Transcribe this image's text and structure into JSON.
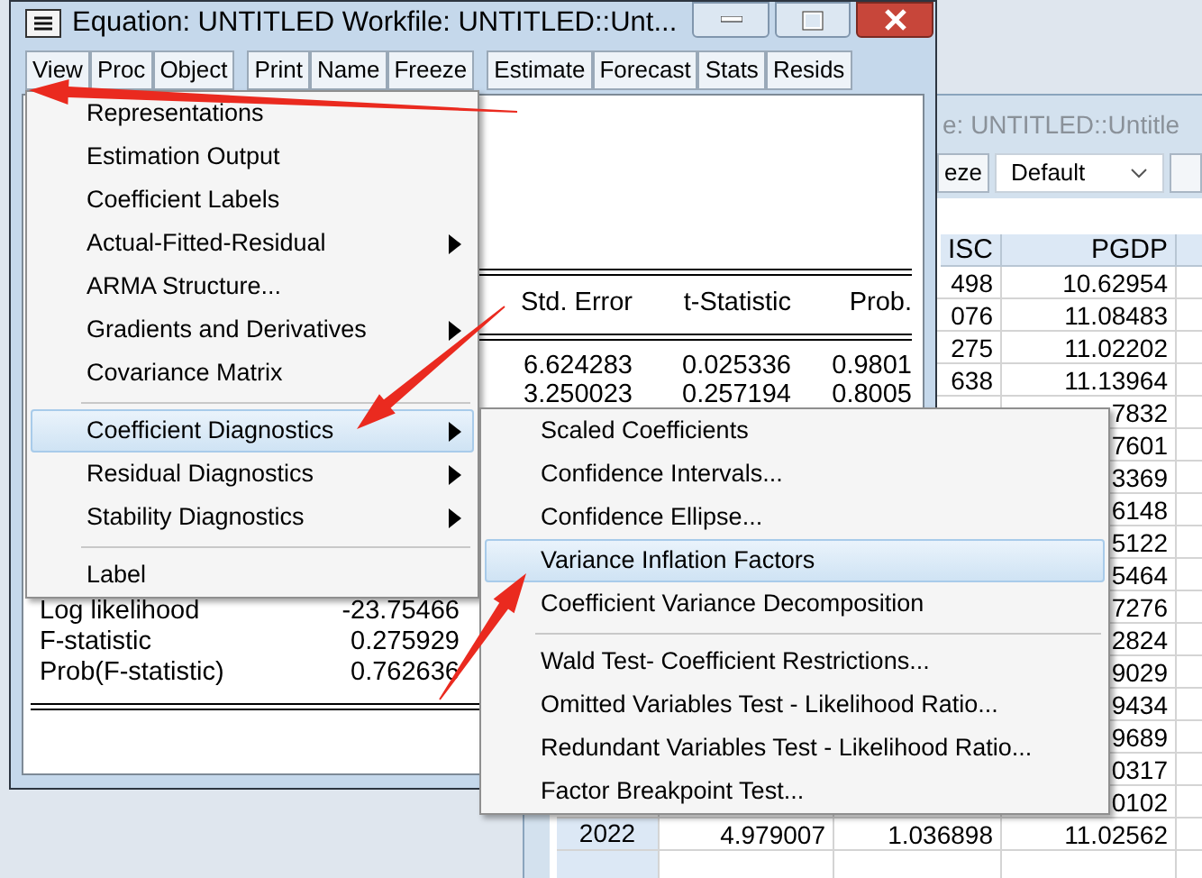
{
  "data_window": {
    "title": "e: UNTITLED::Untitle",
    "toolbar_button": "eze",
    "dropdown": "Default",
    "columns": {
      "isc": "ISC",
      "pgdp": "PGDP"
    },
    "rows": [
      {
        "isc": "498",
        "pgdp": "10.62954"
      },
      {
        "isc": "076",
        "pgdp": "11.08483"
      },
      {
        "isc": "275",
        "pgdp": "11.02202"
      },
      {
        "isc": "638",
        "pgdp": "11.13964"
      },
      {
        "pgdp": "7832"
      },
      {
        "pgdp": "7601"
      },
      {
        "pgdp": "3369"
      },
      {
        "pgdp": "6148"
      },
      {
        "pgdp": "5122"
      },
      {
        "pgdp": "5464"
      },
      {
        "pgdp": "7276"
      },
      {
        "pgdp": "2824"
      },
      {
        "pgdp": "9029"
      },
      {
        "pgdp": "9434"
      },
      {
        "pgdp": "9689"
      },
      {
        "pgdp": "0317"
      },
      {
        "pgdp": "0102"
      },
      {
        "obs": "2022",
        "column_2": "4.979007",
        "isc": "1.036898",
        "pgdp": "11.02562"
      }
    ]
  },
  "equation_window": {
    "title": "Equation: UNTITLED   Workfile: UNTITLED::Unt...",
    "toolbar_groups": [
      [
        "View",
        "Proc",
        "Object"
      ],
      [
        "Print",
        "Name",
        "Freeze"
      ],
      [
        "Estimate",
        "Forecast",
        "Stats",
        "Resids"
      ]
    ],
    "output": {
      "header": [
        "Std. Error",
        "t-Statistic",
        "Prob."
      ],
      "rows": [
        [
          "6.624283",
          "0.025336",
          "0.9801"
        ],
        [
          "3.250023",
          "0.257194",
          "0.8005"
        ]
      ],
      "stats": [
        {
          "label": "Log likelihood",
          "value": "-23.75466"
        },
        {
          "label": "F-statistic",
          "value": "0.275929"
        },
        {
          "label": "Prob(F-statistic)",
          "value": "0.762636"
        }
      ]
    }
  },
  "view_menu": {
    "items": [
      {
        "label": "Representations",
        "submenu": false,
        "selected": false
      },
      {
        "label": "Estimation Output",
        "submenu": false,
        "selected": false
      },
      {
        "label": "Coefficient Labels",
        "submenu": false,
        "selected": false
      },
      {
        "label": "Actual-Fitted-Residual",
        "submenu": true,
        "selected": false
      },
      {
        "label": "ARMA Structure...",
        "submenu": false,
        "selected": false
      },
      {
        "label": "Gradients and Derivatives",
        "submenu": true,
        "selected": false
      },
      {
        "label": "Covariance Matrix",
        "submenu": false,
        "selected": false
      },
      {
        "kind": "separator"
      },
      {
        "label": "Coefficient Diagnostics",
        "submenu": true,
        "selected": true
      },
      {
        "label": "Residual Diagnostics",
        "submenu": true,
        "selected": false
      },
      {
        "label": "Stability Diagnostics",
        "submenu": true,
        "selected": false
      },
      {
        "kind": "separator"
      },
      {
        "label": "Label",
        "submenu": false,
        "selected": false
      }
    ]
  },
  "submenu": {
    "items": [
      {
        "label": "Scaled Coefficients",
        "selected": false
      },
      {
        "label": "Confidence Intervals...",
        "selected": false
      },
      {
        "label": "Confidence Ellipse...",
        "selected": false
      },
      {
        "label": "Variance Inflation Factors",
        "selected": true
      },
      {
        "label": "Coefficient Variance Decomposition",
        "selected": false
      },
      {
        "kind": "separator"
      },
      {
        "label": "Wald Test- Coefficient Restrictions...",
        "selected": false
      },
      {
        "label": "Omitted Variables Test - Likelihood Ratio...",
        "selected": false
      },
      {
        "label": "Redundant Variables Test - Likelihood Ratio...",
        "selected": false
      },
      {
        "label": "Factor Breakpoint Test...",
        "selected": false
      }
    ]
  }
}
